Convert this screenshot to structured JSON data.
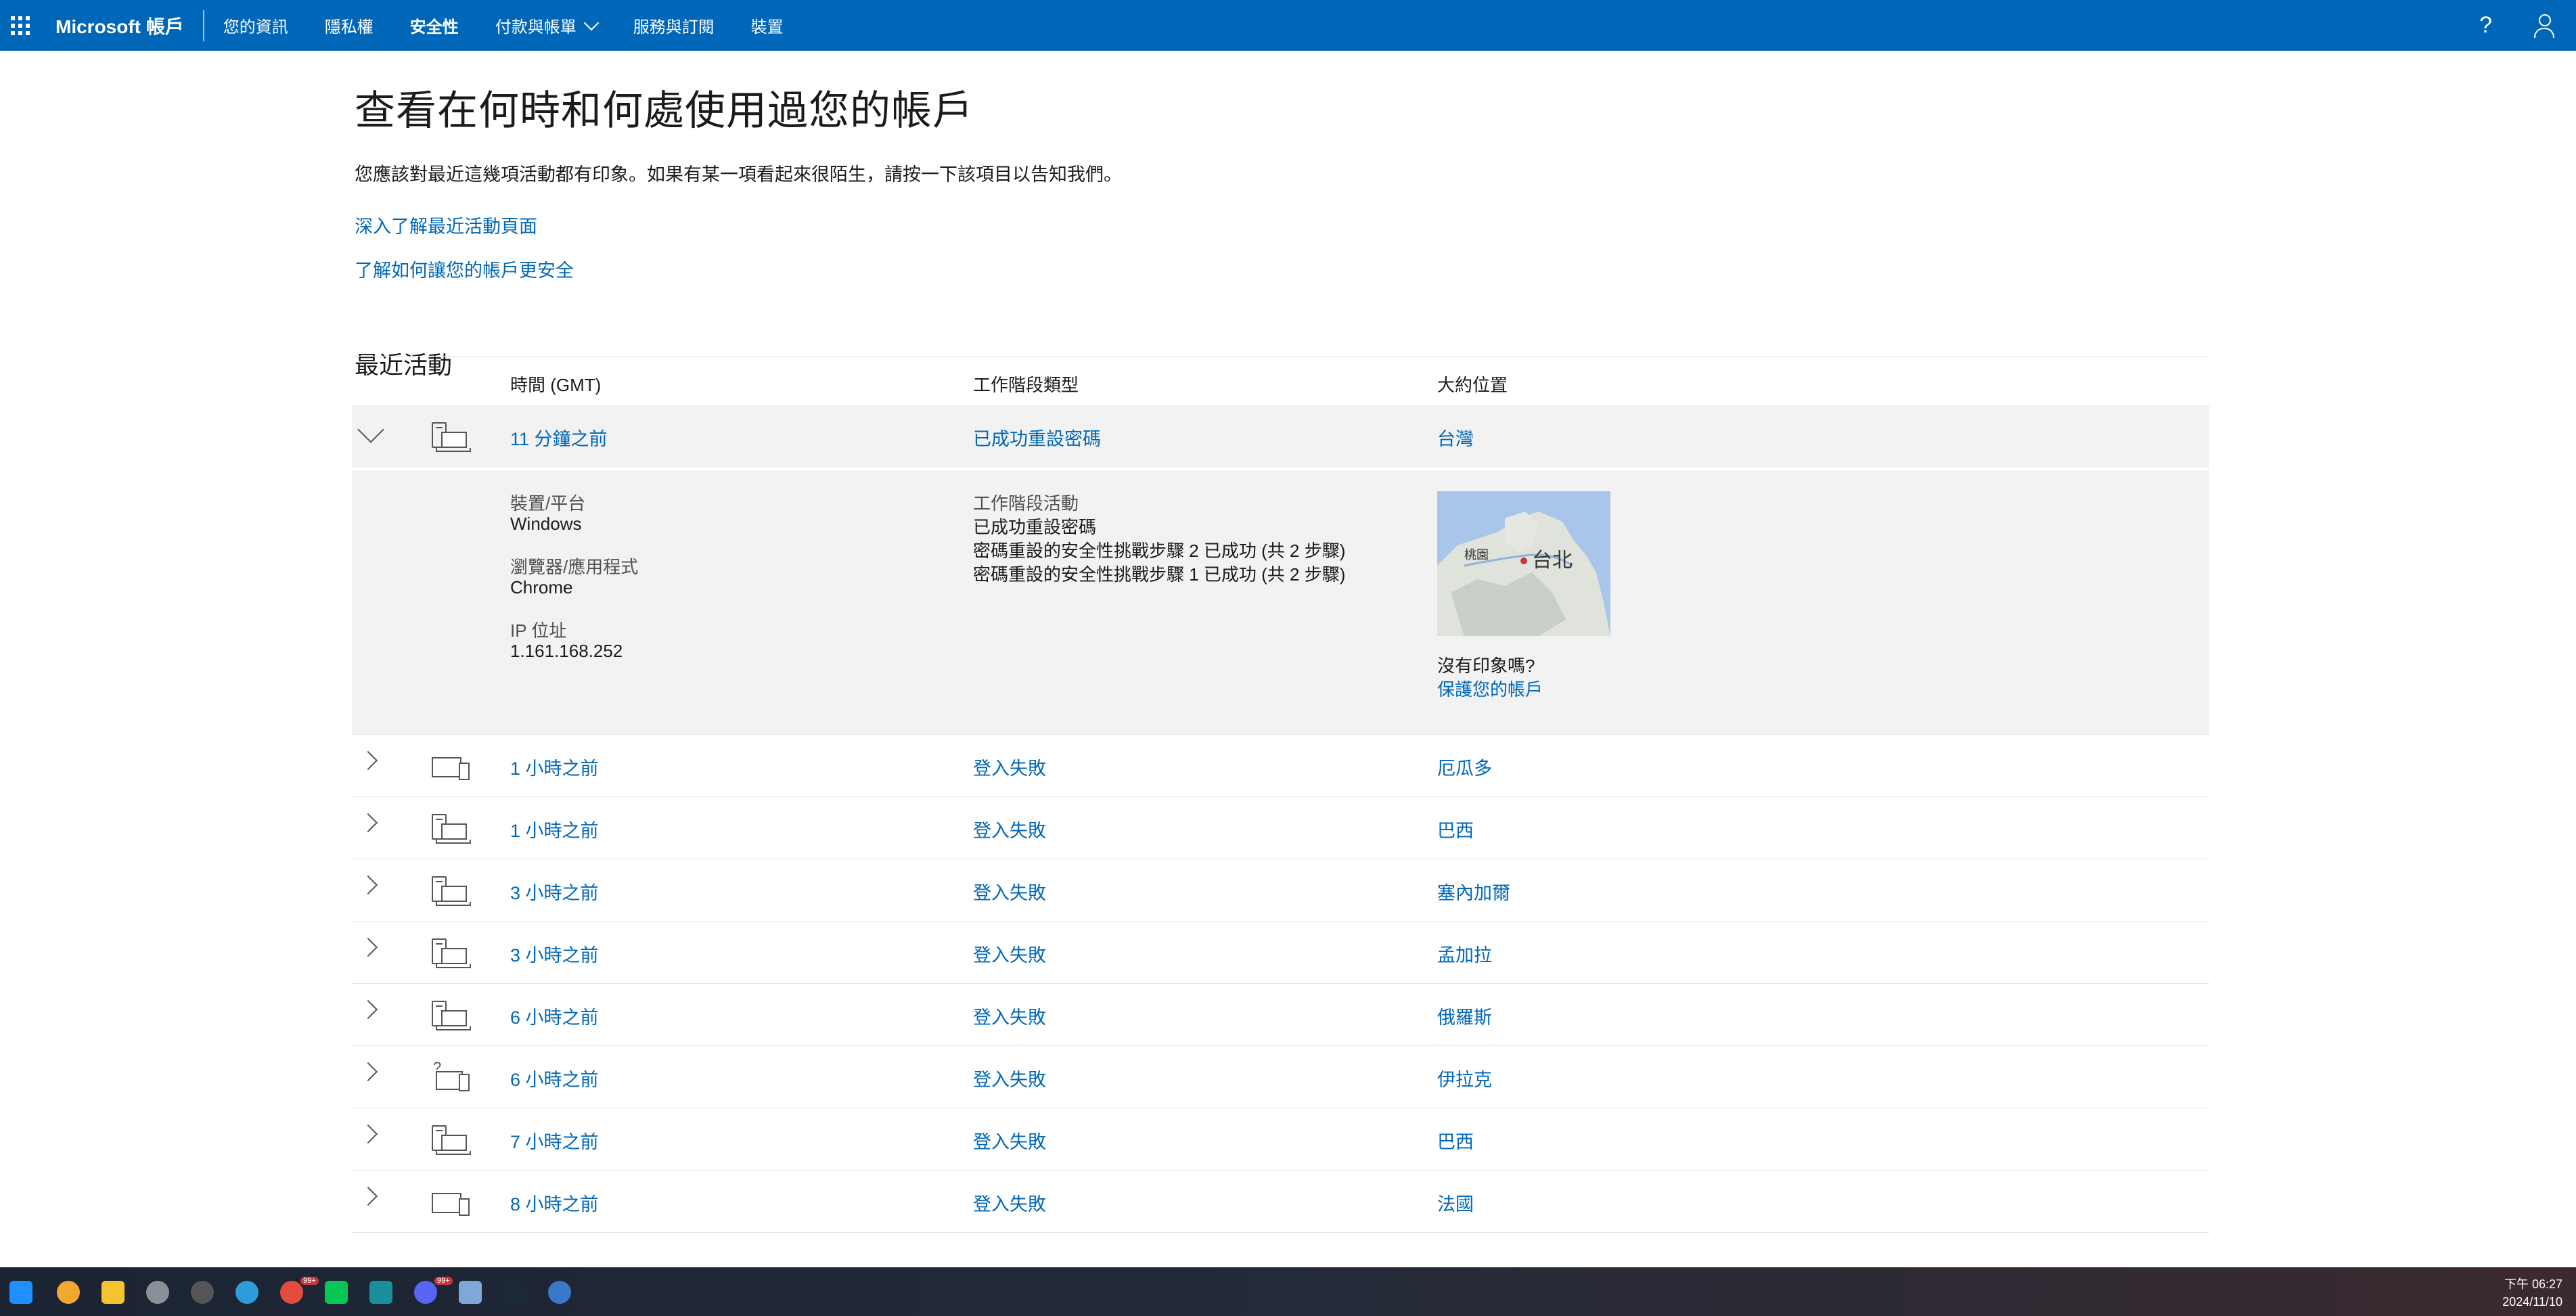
{
  "topbar": {
    "brand": "Microsoft 帳戶",
    "nav": [
      "您的資訊",
      "隱私權",
      "安全性",
      "付款與帳單",
      "服務與訂閱",
      "裝置"
    ],
    "help": "?"
  },
  "page": {
    "title": "查看在何時和何處使用過您的帳戶",
    "intro": "您應該對最近這幾項活動都有印象。如果有某一項看起來很陌生，請按一下該項目以告知我們。",
    "link1": "深入了解最近活動頁面",
    "link2": "了解如何讓您的帳戶更安全",
    "section": "最近活動"
  },
  "table": {
    "headers": [
      "時間 (GMT)",
      "工作階段類型",
      "大約位置"
    ],
    "expanded": {
      "time": "11 分鐘之前",
      "type": "已成功重設密碼",
      "location": "台灣",
      "device_label": "裝置/平台",
      "device_value": "Windows",
      "browser_label": "瀏覽器/應用程式",
      "browser_value": "Chrome",
      "ip_label": "IP 位址",
      "ip_value": "1.161.168.252",
      "activity_label": "工作階段活動",
      "activity_lines": [
        "已成功重設密碼",
        "密碼重設的安全性挑戰步驟 2 已成功 (共 2 步驟)",
        "密碼重設的安全性挑戰步驟 1 已成功 (共 2 步驟)"
      ],
      "map_labels": [
        "桃園",
        "台北"
      ],
      "unfamiliar": "沒有印象嗎?",
      "protect": "保護您的帳戶"
    },
    "rows": [
      {
        "time": "1 小時之前",
        "type": "登入失敗",
        "location": "厄瓜多",
        "icon": "mobile-device-icon"
      },
      {
        "time": "1 小時之前",
        "type": "登入失敗",
        "location": "巴西",
        "icon": "desktop-icon"
      },
      {
        "time": "3 小時之前",
        "type": "登入失敗",
        "location": "塞內加爾",
        "icon": "desktop-icon"
      },
      {
        "time": "3 小時之前",
        "type": "登入失敗",
        "location": "孟加拉",
        "icon": "desktop-icon"
      },
      {
        "time": "6 小時之前",
        "type": "登入失敗",
        "location": "俄羅斯",
        "icon": "desktop-icon"
      },
      {
        "time": "6 小時之前",
        "type": "登入失敗",
        "location": "伊拉克",
        "icon": "unknown-device-icon"
      },
      {
        "time": "7 小時之前",
        "type": "登入失敗",
        "location": "巴西",
        "icon": "desktop-icon"
      },
      {
        "time": "8 小時之前",
        "type": "登入失敗",
        "location": "法國",
        "icon": "mobile-device-icon"
      }
    ]
  },
  "taskbar": {
    "time": "下午 06:27",
    "date": "2024/11/10",
    "badges": [
      "99+",
      "99+"
    ]
  },
  "colors": {
    "accent": "#0067b8",
    "expanded_bg": "#f2f2f2"
  }
}
